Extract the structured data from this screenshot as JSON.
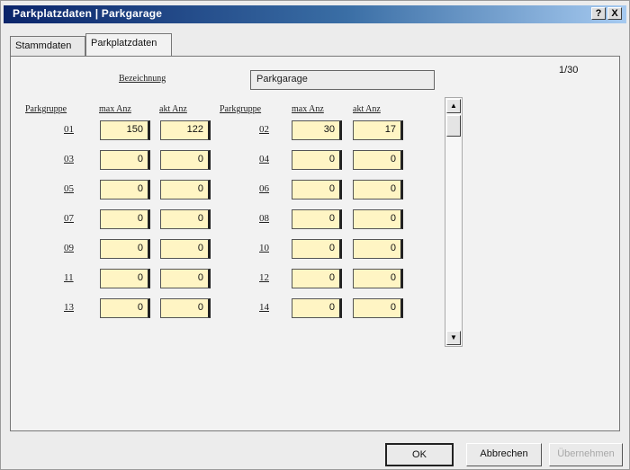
{
  "window": {
    "title": "Parkplatzdaten | Parkgarage",
    "help_btn": "?",
    "close_btn": "X"
  },
  "tabs": [
    {
      "label": "Stammdaten",
      "active": false
    },
    {
      "label": "Parkplatzdaten",
      "active": true
    }
  ],
  "form": {
    "name_label": "Bezeichnung",
    "name_value": "Parkgarage",
    "counter": "1/30",
    "col_headers": {
      "group": "Parkgruppe",
      "max": "max Anz",
      "current": "akt Anz"
    },
    "rows": [
      {
        "left": {
          "group": "01",
          "max": "150",
          "current": "122"
        },
        "right": {
          "group": "02",
          "max": "30",
          "current": "17"
        }
      },
      {
        "left": {
          "group": "03",
          "max": "0",
          "current": "0"
        },
        "right": {
          "group": "04",
          "max": "0",
          "current": "0"
        }
      },
      {
        "left": {
          "group": "05",
          "max": "0",
          "current": "0"
        },
        "right": {
          "group": "06",
          "max": "0",
          "current": "0"
        }
      },
      {
        "left": {
          "group": "07",
          "max": "0",
          "current": "0"
        },
        "right": {
          "group": "08",
          "max": "0",
          "current": "0"
        }
      },
      {
        "left": {
          "group": "09",
          "max": "0",
          "current": "0"
        },
        "right": {
          "group": "10",
          "max": "0",
          "current": "0"
        }
      },
      {
        "left": {
          "group": "11",
          "max": "0",
          "current": "0"
        },
        "right": {
          "group": "12",
          "max": "0",
          "current": "0"
        }
      },
      {
        "left": {
          "group": "13",
          "max": "0",
          "current": "0"
        },
        "right": {
          "group": "14",
          "max": "0",
          "current": "0"
        }
      }
    ]
  },
  "buttons": {
    "ok": "OK",
    "cancel": "Abbrechen",
    "apply": "Übernehmen"
  },
  "icons": {
    "scroll_up": "up-arrow-icon",
    "scroll_down": "down-arrow-icon"
  }
}
